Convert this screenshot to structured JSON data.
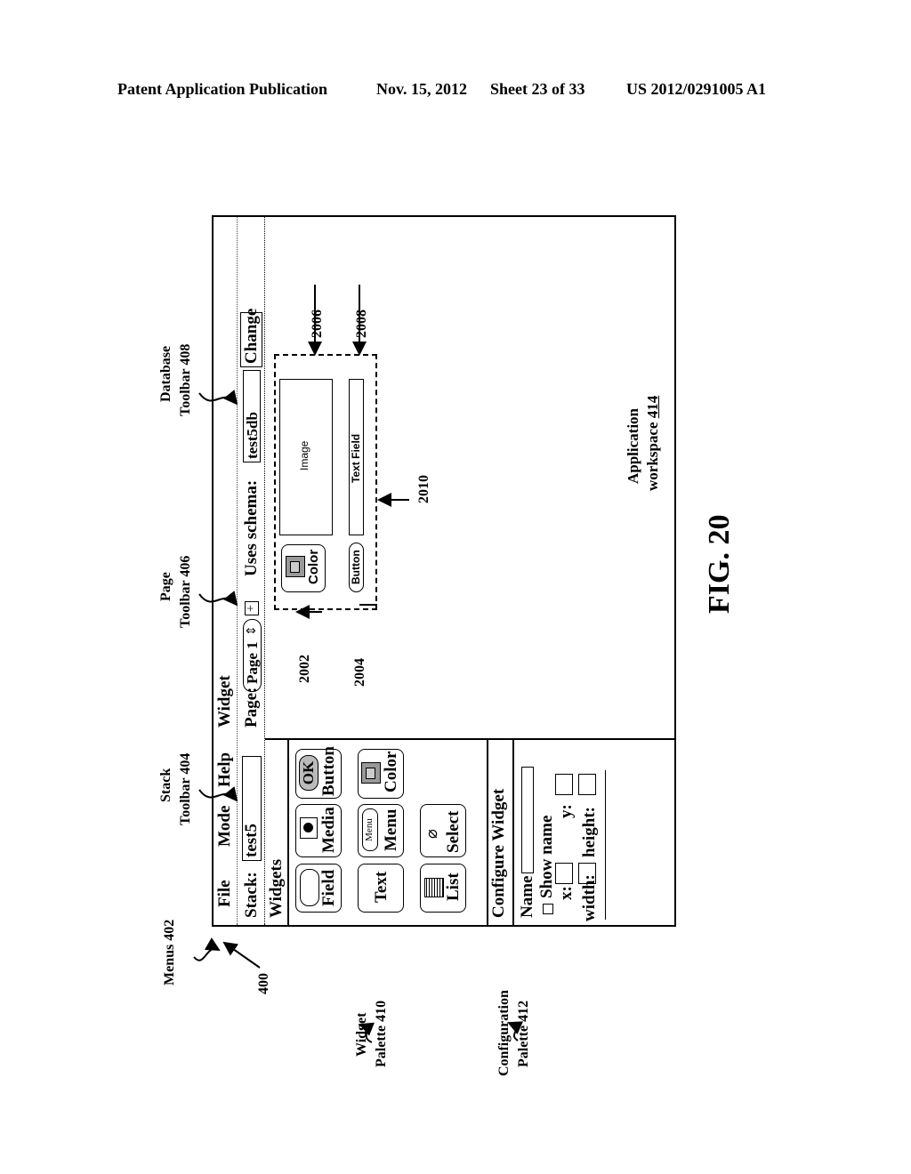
{
  "header": {
    "publication": "Patent Application Publication",
    "date": "Nov. 15, 2012",
    "sheet": "Sheet 23 of 33",
    "number": "US 2012/0291005 A1"
  },
  "figure_label": "FIG. 20",
  "menus": [
    "File",
    "Mode",
    "Help",
    "Widget"
  ],
  "stack_toolbar": {
    "label": "Stack:",
    "value": "test5"
  },
  "page_toolbar": {
    "label": "Page:",
    "value": "Page 1",
    "add_icon": "plus-icon",
    "stepper_icon": "up-down-arrows-icon"
  },
  "database_toolbar": {
    "label": "Uses schema:",
    "value": "test5db",
    "button": "Change"
  },
  "widget_palette": {
    "title": "Widgets",
    "items": [
      {
        "label": "Field",
        "icon": "field-icon"
      },
      {
        "label": "Media",
        "icon": "camera-icon"
      },
      {
        "label": "Button",
        "icon": "ok-button-icon",
        "icon_text": "OK"
      },
      {
        "label": "Text",
        "icon": ""
      },
      {
        "label": "Menu",
        "icon": "menu-dropdown-icon",
        "icon_text": "Menu"
      },
      {
        "label": "Color",
        "icon": "color-swatch-icon"
      },
      {
        "label": "List",
        "icon": "list-icon"
      },
      {
        "label": "Select",
        "icon": "select-cursor-icon"
      }
    ]
  },
  "config_palette": {
    "title": "Configure Widget",
    "name_label": "Name",
    "show_name_label": "Show name",
    "x_label": "x:",
    "y_label": "y:",
    "width_label": "width:",
    "height_label": "height:"
  },
  "workspace": {
    "color_widget_label": "Color",
    "image_label": "Image",
    "button_label": "Button",
    "text_field_label": "Text Field",
    "caption": "Application",
    "caption2": "workspace",
    "caption_ref": "414"
  },
  "callouts": {
    "menus": "Menus 402",
    "stack_toolbar_1": "Stack",
    "stack_toolbar_2": "Toolbar 404",
    "page_toolbar_1": "Page",
    "page_toolbar_2": "Toolbar 406",
    "database_toolbar_1": "Database",
    "database_toolbar_2": "Toolbar 408",
    "widget_palette_1": "Widget",
    "widget_palette_2": "Palette 410",
    "config_palette_1": "Configuration",
    "config_palette_2": "Palette 412",
    "ref_400": "400",
    "ref_2002": "2002",
    "ref_2004": "2004",
    "ref_2006": "2006",
    "ref_2008": "2008",
    "ref_2010": "2010"
  }
}
